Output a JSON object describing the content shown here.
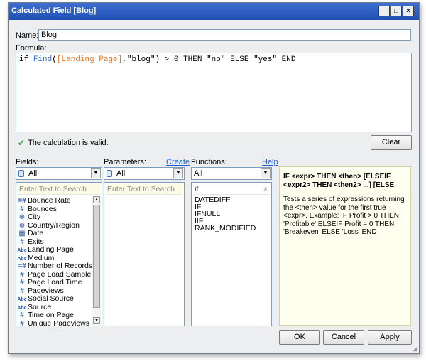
{
  "window": {
    "title": "Calculated Field [Blog]",
    "minimize": "_",
    "maximize": "□",
    "close": "×"
  },
  "name": {
    "label": "Name:",
    "value": "Blog"
  },
  "formula": {
    "label": "Formula:",
    "tokens": {
      "kw_if": "if ",
      "fn_find": "Find",
      "paren_open": "(",
      "field": "[Landing Page]",
      "rest1": ",\"blog\") > 0 THEN \"no\" ELSE \"yes\" END"
    }
  },
  "status": {
    "text": "The calculation is valid.",
    "icon": "checkmark-icon",
    "clear": "Clear"
  },
  "fields": {
    "label": "Fields:",
    "select_value": "All",
    "search_placeholder": "Enter Text to Search",
    "items": [
      {
        "icon": "=#",
        "label": "Bounce Rate"
      },
      {
        "icon": "#",
        "label": "Bounces"
      },
      {
        "icon": "⊕",
        "label": "City"
      },
      {
        "icon": "⊕",
        "label": "Country/Region"
      },
      {
        "icon": "▦",
        "label": "Date"
      },
      {
        "icon": "#",
        "label": "Exits"
      },
      {
        "icon": "Abc",
        "label": "Landing Page"
      },
      {
        "icon": "Abc",
        "label": "Medium"
      },
      {
        "icon": "=#",
        "label": "Number of Records"
      },
      {
        "icon": "#",
        "label": "Page Load Sample"
      },
      {
        "icon": "#",
        "label": "Page Load Time"
      },
      {
        "icon": "#",
        "label": "Pageviews"
      },
      {
        "icon": "Abc",
        "label": "Social Source"
      },
      {
        "icon": "Abc",
        "label": "Source"
      },
      {
        "icon": "#",
        "label": "Time on Page"
      },
      {
        "icon": "#",
        "label": "Unique Pageviews"
      }
    ]
  },
  "parameters": {
    "label": "Parameters:",
    "create": "Create",
    "select_value": "All",
    "search_placeholder": "Enter Text to Search"
  },
  "functions": {
    "label": "Functions:",
    "help": "Help",
    "select_value": "All",
    "search_value": "if",
    "clear_search": "×",
    "items": [
      "DATEDIFF",
      "IF",
      "IFNULL",
      "IIF",
      "RANK_MODIFIED"
    ]
  },
  "help_panel": {
    "signature": "IF <expr> THEN <then> [ELSEIF <expr2> THEN <then2> ...] [ELSE",
    "description": "Tests a series of expressions returning the <then> value for the first true <expr>. Example: IF Profit > 0 THEN 'Profitable' ELSEIF Profit = 0 THEN 'Breakeven' ELSE 'Loss' END"
  },
  "buttons": {
    "ok": "OK",
    "cancel": "Cancel",
    "apply": "Apply"
  },
  "colors": {
    "title_bar": "#2a5bc2",
    "function_token": "#2f6fd1",
    "field_token": "#e07b2b",
    "link": "#1d5fd1"
  }
}
